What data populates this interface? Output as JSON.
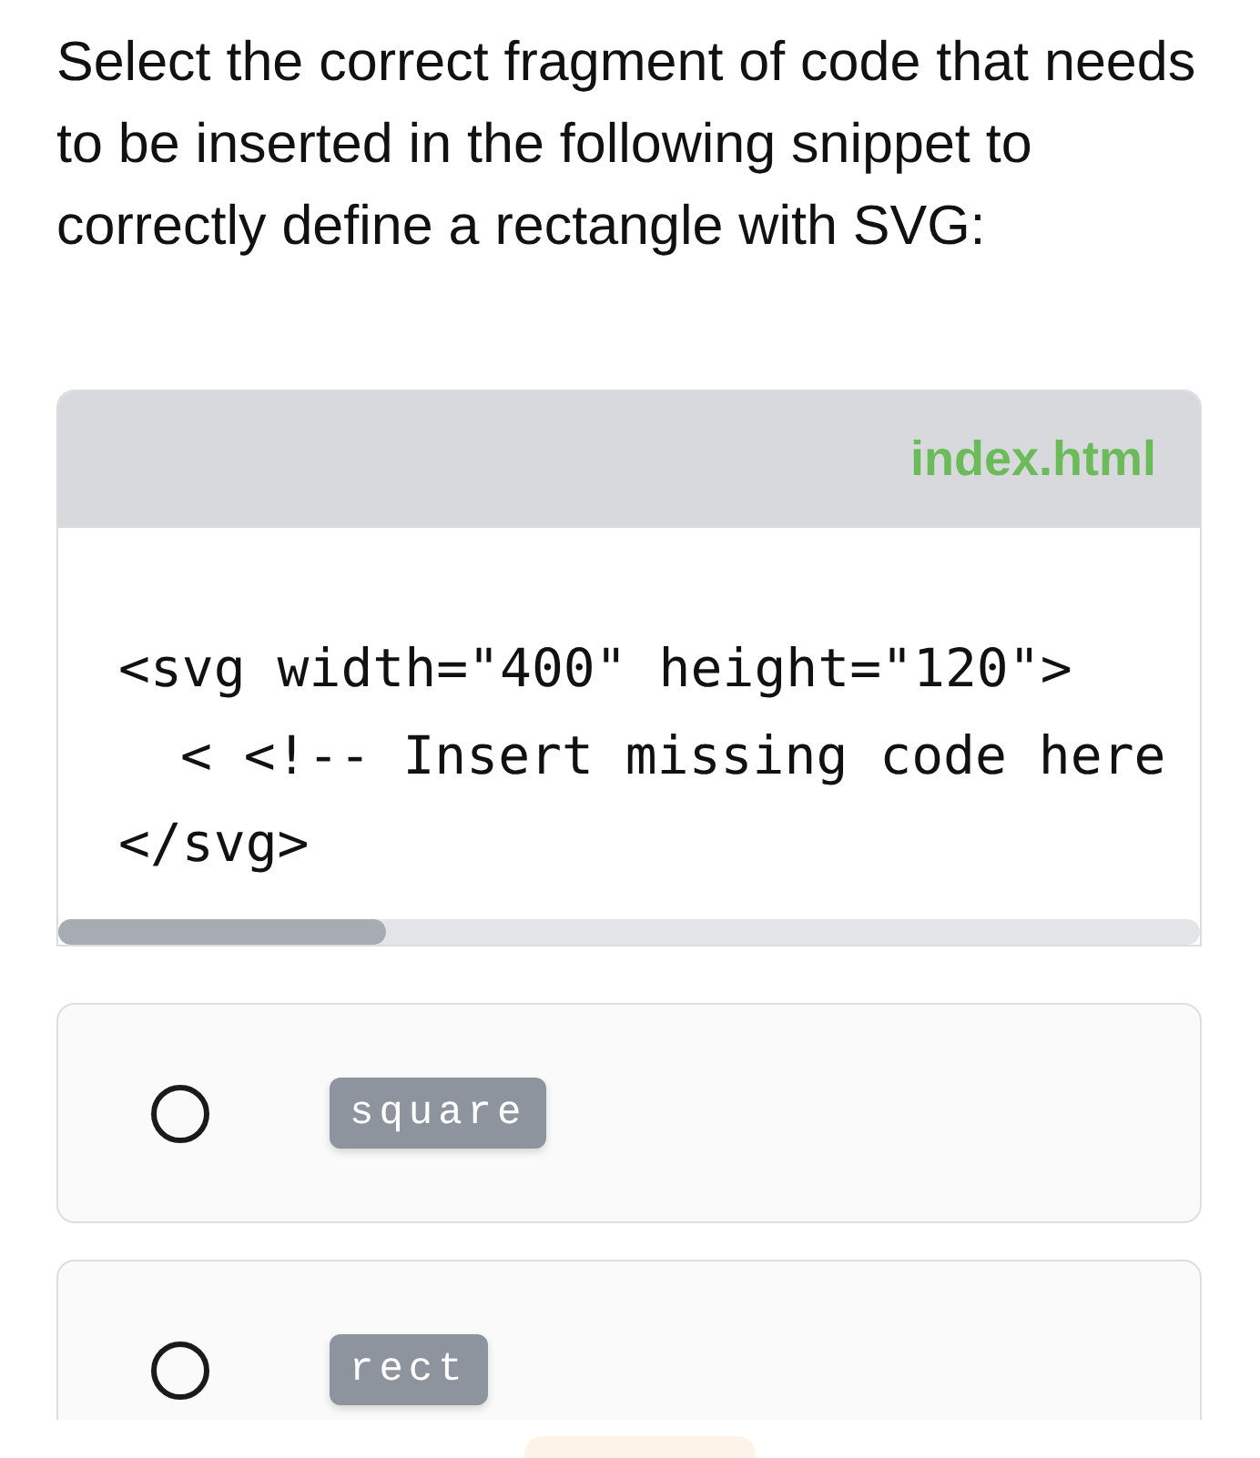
{
  "question": "Select the correct fragment of code that needs to be inserted in the following snippet to correctly define a rectangle with SVG:",
  "code_block": {
    "filename": "index.html",
    "lines": [
      {
        "text": "<svg width=\"400\" height=\"120\">",
        "indented": false
      },
      {
        "text": "< <!-- Insert missing code here",
        "indented": true
      },
      {
        "text": "</svg>",
        "indented": false
      }
    ]
  },
  "options": [
    {
      "code": "square",
      "selected": false
    },
    {
      "code": "rect",
      "selected": false
    }
  ]
}
